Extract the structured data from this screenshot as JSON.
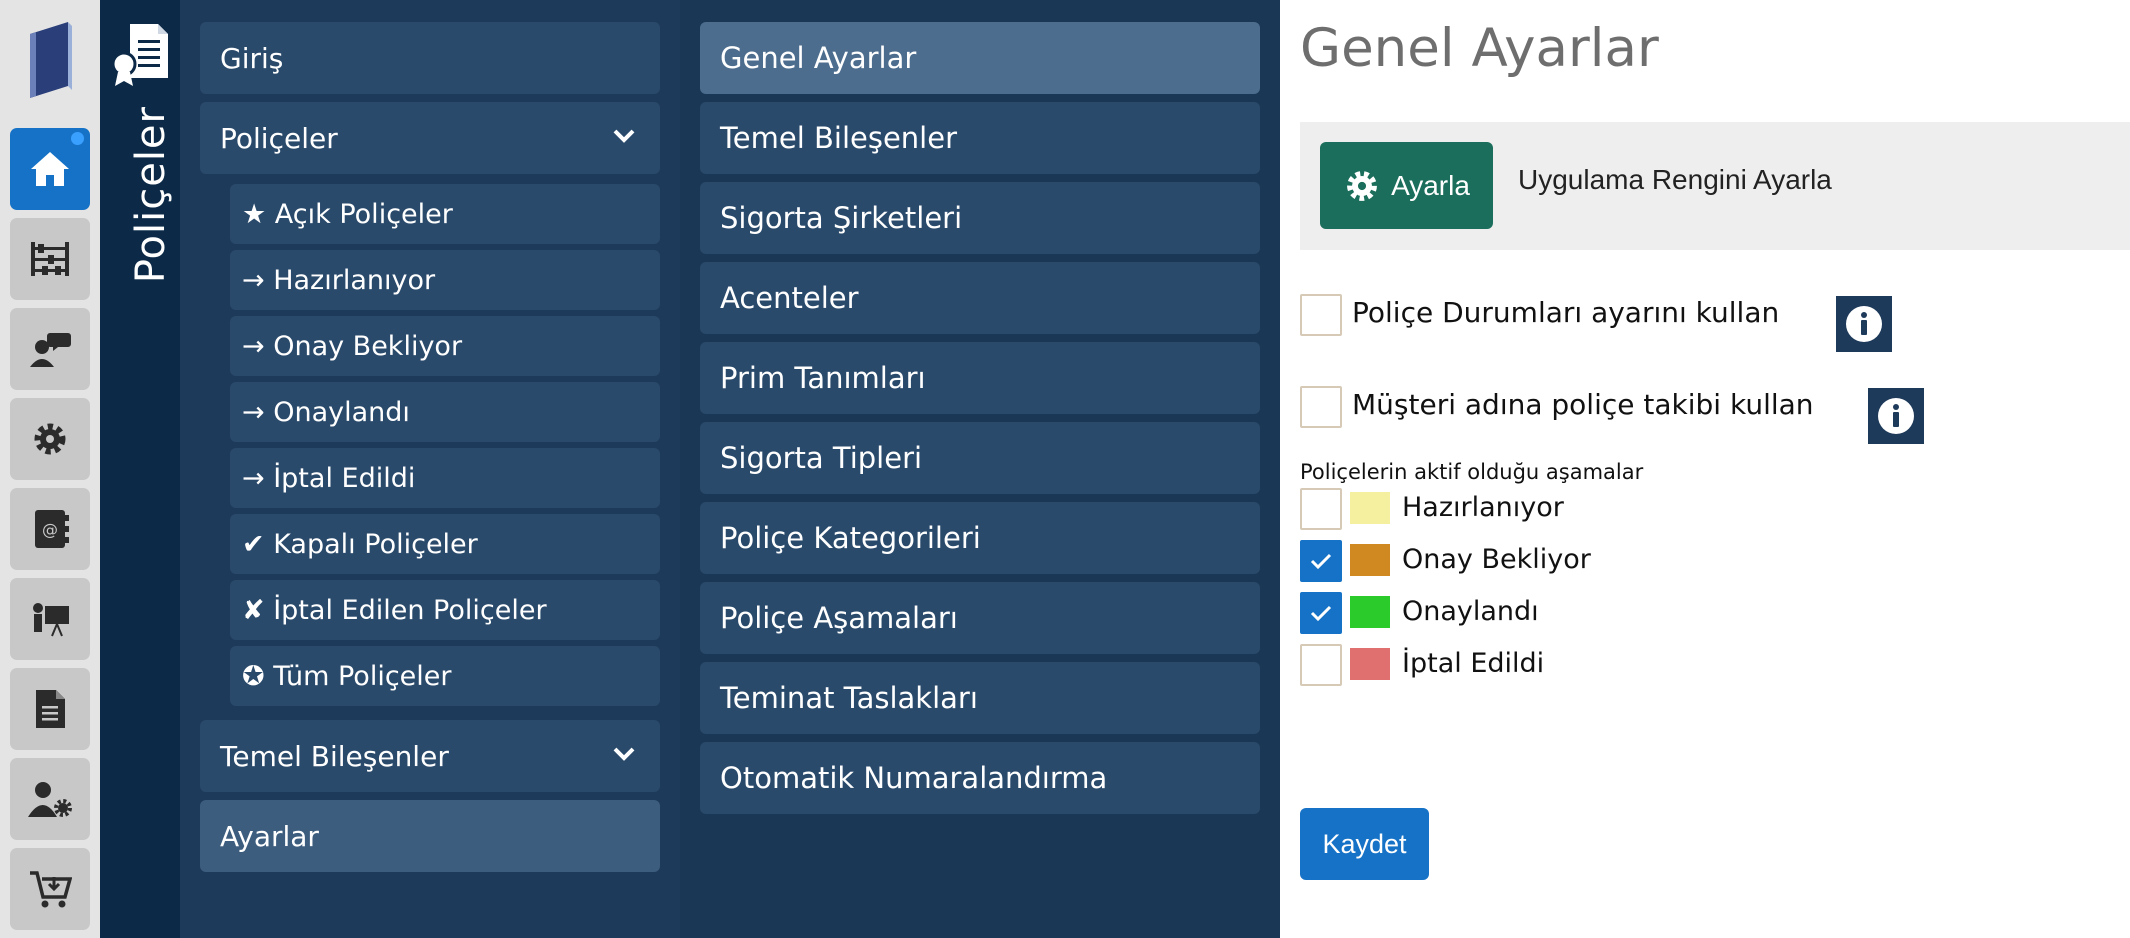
{
  "module": {
    "title": "Poliçeler"
  },
  "rail": {
    "items": [
      {
        "icon": "home-icon",
        "active": true
      },
      {
        "icon": "abacus-icon"
      },
      {
        "icon": "customer-chat-icon"
      },
      {
        "icon": "gear-icon"
      },
      {
        "icon": "contacts-book-icon"
      },
      {
        "icon": "presentation-icon"
      },
      {
        "icon": "document-icon"
      },
      {
        "icon": "user-settings-icon"
      },
      {
        "icon": "cart-download-icon"
      }
    ]
  },
  "nav": {
    "giris": "Giriş",
    "policeler": "Poliçeler",
    "sub": {
      "acik": "★ Açık Poliçeler",
      "hazirlaniyor": "→ Hazırlanıyor",
      "onay_bekliyor": "→ Onay Bekliyor",
      "onaylandi": "→ Onaylandı",
      "iptal_edildi": "→ İptal Edildi",
      "kapali": "✔ Kapalı Poliçeler",
      "iptal_edilen": "✘ İptal Edilen Poliçeler",
      "tum": "✪ Tüm Poliçeler"
    },
    "temel": "Temel Bileşenler",
    "ayarlar": "Ayarlar"
  },
  "settings_menu": {
    "items": [
      "Genel Ayarlar",
      "Temel Bileşenler",
      "Sigorta Şirketleri",
      "Acenteler",
      "Prim Tanımları",
      "Sigorta Tipleri",
      "Poliçe Kategorileri",
      "Poliçe Aşamaları",
      "Teminat Taslakları",
      "Otomatik Numaralandırma"
    ],
    "active_index": 0
  },
  "main": {
    "title": "Genel Ayarlar",
    "color_button": "Ayarla",
    "color_label": "Uygulama Rengini Ayarla",
    "options": {
      "durum": {
        "label": "Poliçe Durumları ayarını kullan",
        "checked": false
      },
      "musteri": {
        "label": "Müşteri adına poliçe takibi kullan",
        "checked": false
      }
    },
    "stages_heading": "Poliçelerin aktif olduğu aşamalar",
    "stages": [
      {
        "label": "Hazırlanıyor",
        "checked": false,
        "color": "#f5f0a0"
      },
      {
        "label": "Onay Bekliyor",
        "checked": true,
        "color": "#d08820"
      },
      {
        "label": "Onaylandı",
        "checked": true,
        "color": "#2ccb2c"
      },
      {
        "label": "İptal Edildi",
        "checked": false,
        "color": "#e07070"
      }
    ],
    "save": "Kaydet"
  },
  "colors": {
    "primary": "#1672c6",
    "nav_bg": "#1e3a5a",
    "settings_bg": "#1a3856",
    "color_button": "#1b6e5b"
  }
}
